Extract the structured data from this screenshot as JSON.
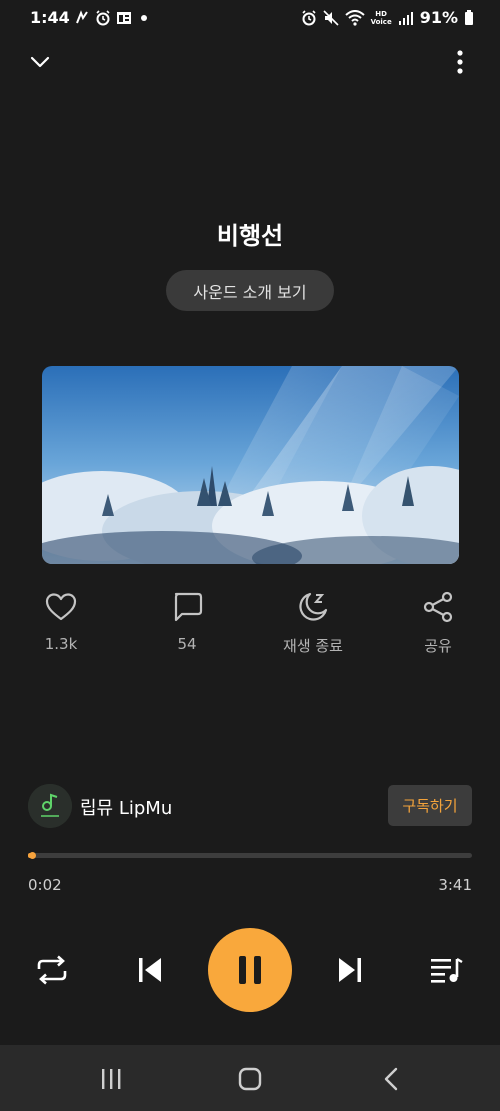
{
  "status_bar": {
    "time": "1:44",
    "battery": "91%",
    "hd_line1": "HD",
    "hd_line2": "Voice",
    "left_icons": [
      "wave-icon",
      "alarm-icon",
      "news-icon",
      "dot-icon"
    ],
    "right_icons": [
      "alarm-icon",
      "mute-icon",
      "wifi-icon",
      "signal-icon",
      "battery-icon"
    ]
  },
  "header": {
    "collapse_icon": "chevron-down-icon",
    "more_icon": "more-vertical-icon"
  },
  "track": {
    "title": "비행선",
    "intro_button": "사운드 소개 보기"
  },
  "actions": {
    "like": {
      "icon": "heart-icon",
      "label": "1.3k"
    },
    "comment": {
      "icon": "comment-icon",
      "label": "54"
    },
    "sleep": {
      "icon": "sleep-timer-icon",
      "label": "재생 종료"
    },
    "share": {
      "icon": "share-icon",
      "label": "공유"
    }
  },
  "channel": {
    "name": "립뮤 LipMu",
    "subscribe": "구독하기"
  },
  "playback": {
    "current_time": "0:02",
    "total_time": "3:41",
    "progress": 0.009,
    "accent_color": "#F9A83C"
  },
  "controls": {
    "repeat_icon": "repeat-icon",
    "previous_icon": "skip-previous-icon",
    "play_pause_icon": "pause-icon",
    "next_icon": "skip-next-icon",
    "queue_icon": "playlist-icon"
  },
  "nav": {
    "recent_icon": "recent-apps-icon",
    "home_icon": "home-icon",
    "back_icon": "back-icon"
  }
}
